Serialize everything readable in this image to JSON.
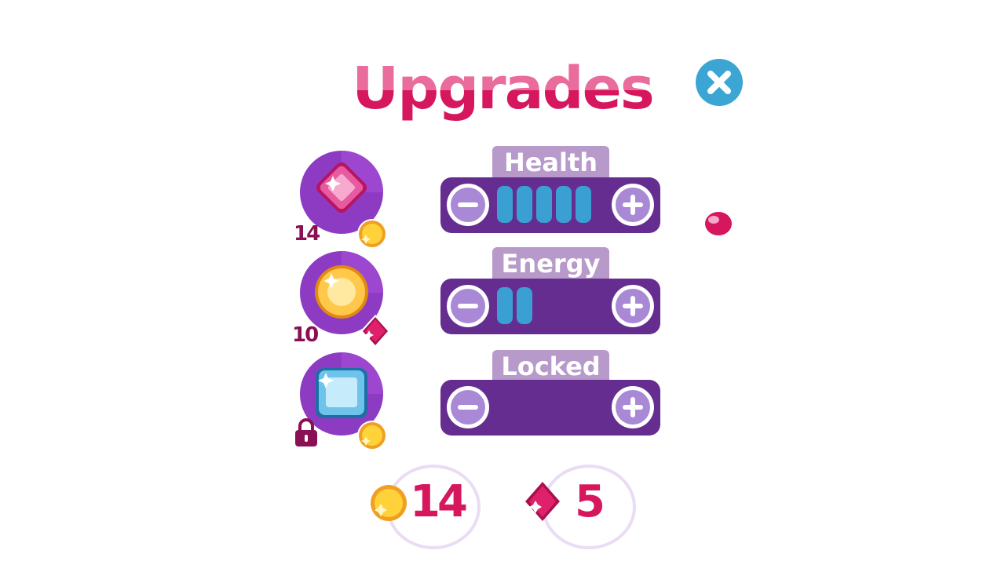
{
  "title": "Upgrades",
  "close_icon": "close-icon",
  "items": [
    {
      "gem": "pink-gem-icon",
      "cost": "14",
      "currency_icon": "coin-icon"
    },
    {
      "gem": "gold-gem-icon",
      "cost": "10",
      "currency_icon": "pink-diamond-icon"
    },
    {
      "gem": "blue-gem-icon",
      "locked": true,
      "lock_icon": "lock-icon",
      "currency_icon": "coin-icon"
    }
  ],
  "stats": [
    {
      "label": "Health",
      "level": 5
    },
    {
      "label": "Energy",
      "level": 2
    },
    {
      "label": "Locked",
      "level": 0
    }
  ],
  "currency": {
    "coins": "14",
    "gems": "5"
  },
  "colors": {
    "title_top": "#ea6c9d",
    "title_bottom": "#d6165d",
    "panel": "#652d90",
    "tab": "#b79ac9",
    "pip": "#3a9fd2",
    "button": "#a988d6",
    "close": "#3ba5d4"
  }
}
